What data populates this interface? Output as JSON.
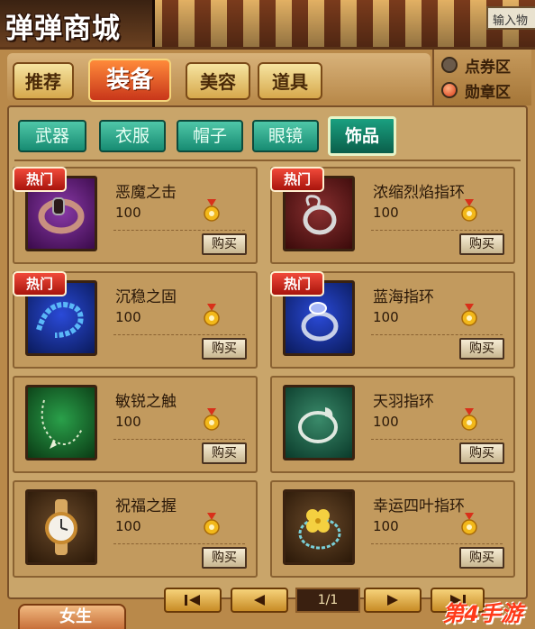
{
  "window": {
    "title": "弹弹商城",
    "input_placeholder": "输入物"
  },
  "main_tabs": [
    {
      "label": "推荐",
      "active": false
    },
    {
      "label": "装备",
      "active": true
    },
    {
      "label": "美容",
      "active": false
    },
    {
      "label": "道具",
      "active": false
    }
  ],
  "zones": [
    {
      "label": "点券区",
      "selected": false
    },
    {
      "label": "勋章区",
      "selected": true
    }
  ],
  "sub_tabs": [
    {
      "label": "武器",
      "active": false
    },
    {
      "label": "衣服",
      "active": false
    },
    {
      "label": "帽子",
      "active": false
    },
    {
      "label": "眼镜",
      "active": false
    },
    {
      "label": "饰品",
      "active": true
    }
  ],
  "hot_label": "热门",
  "buy_label": "购买",
  "items": [
    {
      "name": "恶魔之击",
      "price": "100",
      "hot": true,
      "bg": "purple",
      "icon": "bracelet-icon"
    },
    {
      "name": "浓缩烈焰指环",
      "price": "100",
      "hot": true,
      "bg": "darkred",
      "icon": "ring-icon"
    },
    {
      "name": "沉稳之固",
      "price": "100",
      "hot": true,
      "bg": "blue",
      "icon": "chain-bracelet-icon"
    },
    {
      "name": "蓝海指环",
      "price": "100",
      "hot": true,
      "bg": "blue",
      "icon": "gem-ring-icon"
    },
    {
      "name": "敏锐之触",
      "price": "100",
      "hot": false,
      "bg": "green",
      "icon": "necklace-icon"
    },
    {
      "name": "天羽指环",
      "price": "100",
      "hot": false,
      "bg": "teal",
      "icon": "dragon-ring-icon"
    },
    {
      "name": "祝福之握",
      "price": "100",
      "hot": false,
      "bg": "brown",
      "icon": "watch-icon"
    },
    {
      "name": "幸运四叶指环",
      "price": "100",
      "hot": false,
      "bg": "brown",
      "icon": "clover-ring-icon"
    }
  ],
  "footer": {
    "gender_tab": "女生",
    "page_indicator": "1/1",
    "watermark": "第4手游"
  },
  "colors": {
    "accent": "#c8361a",
    "panel": "#b9894a",
    "subtab": "#178b72"
  }
}
